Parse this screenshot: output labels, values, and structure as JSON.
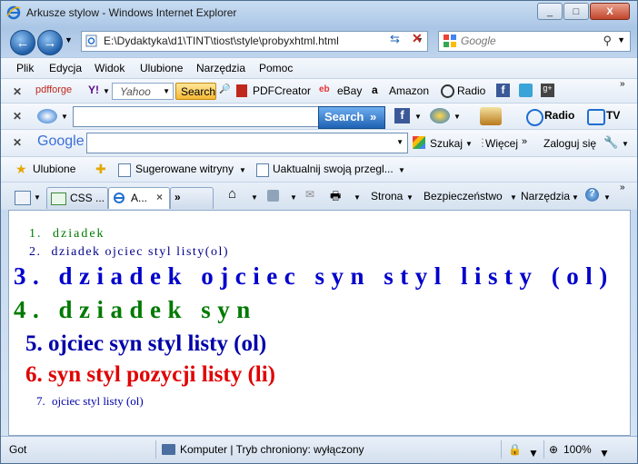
{
  "window": {
    "title": "Arkusze stylow - Windows Internet Explorer",
    "buttons": {
      "minimize": "_",
      "maximize": "□",
      "close": "X"
    }
  },
  "address_bar": {
    "url": "E:\\Dydaktyka\\d1\\TINT\\tiost\\style\\probyxhtml.html",
    "search_placeholder": "Google"
  },
  "menu": [
    "Plik",
    "Edycja",
    "Widok",
    "Ulubione",
    "Narzędzia",
    "Pomoc"
  ],
  "toolbar_pdfforge": {
    "brand": "pdfforge",
    "yahoo": "Yahoo",
    "search_label": "Search",
    "items": [
      "PDFCreator",
      "eBay",
      "Amazon",
      "Radio"
    ]
  },
  "toolbar_search2": {
    "search_label": "Search",
    "radio": "Radio",
    "tv": "TV"
  },
  "toolbar_google": {
    "brand": "Google",
    "search_label": "Szukaj",
    "more_label": "Więcej",
    "login_label": "Zaloguj się"
  },
  "favorites_bar": {
    "favorites_label": "Ulubione",
    "suggested_label": "Sugerowane witryny",
    "update_label": "Uaktualnij swoją przegl..."
  },
  "tabs": [
    {
      "label": "CSS ..."
    },
    {
      "label": "A..."
    }
  ],
  "command_bar": {
    "page_label": "Strona",
    "safety_label": "Bezpieczeństwo",
    "tools_label": "Narzędzia"
  },
  "content": {
    "items": [
      {
        "number": "1.",
        "text": "dziadek",
        "color": "#007a00"
      },
      {
        "number": "2.",
        "text": "dziadek ojciec styl listy(ol)",
        "color": "#00008b"
      },
      {
        "number": "3.",
        "text": "dziadek ojciec syn styl listy (ol)",
        "color": "#0000cc"
      },
      {
        "number": "4.",
        "text": "dziadek syn",
        "color": "#007a00"
      },
      {
        "number": "5.",
        "text": "ojciec syn styl listy (ol)",
        "color": "#0000aa"
      },
      {
        "number": "6.",
        "text": "syn styl pozycji listy (li)",
        "color": "#e00000"
      },
      {
        "number": "7.",
        "text": "ojciec styl listy (ol)",
        "color": "#0000aa"
      }
    ]
  },
  "status_bar": {
    "left": "Got",
    "zone": "Komputer | Tryb chroniony: wyłączony",
    "zoom": "100%"
  }
}
